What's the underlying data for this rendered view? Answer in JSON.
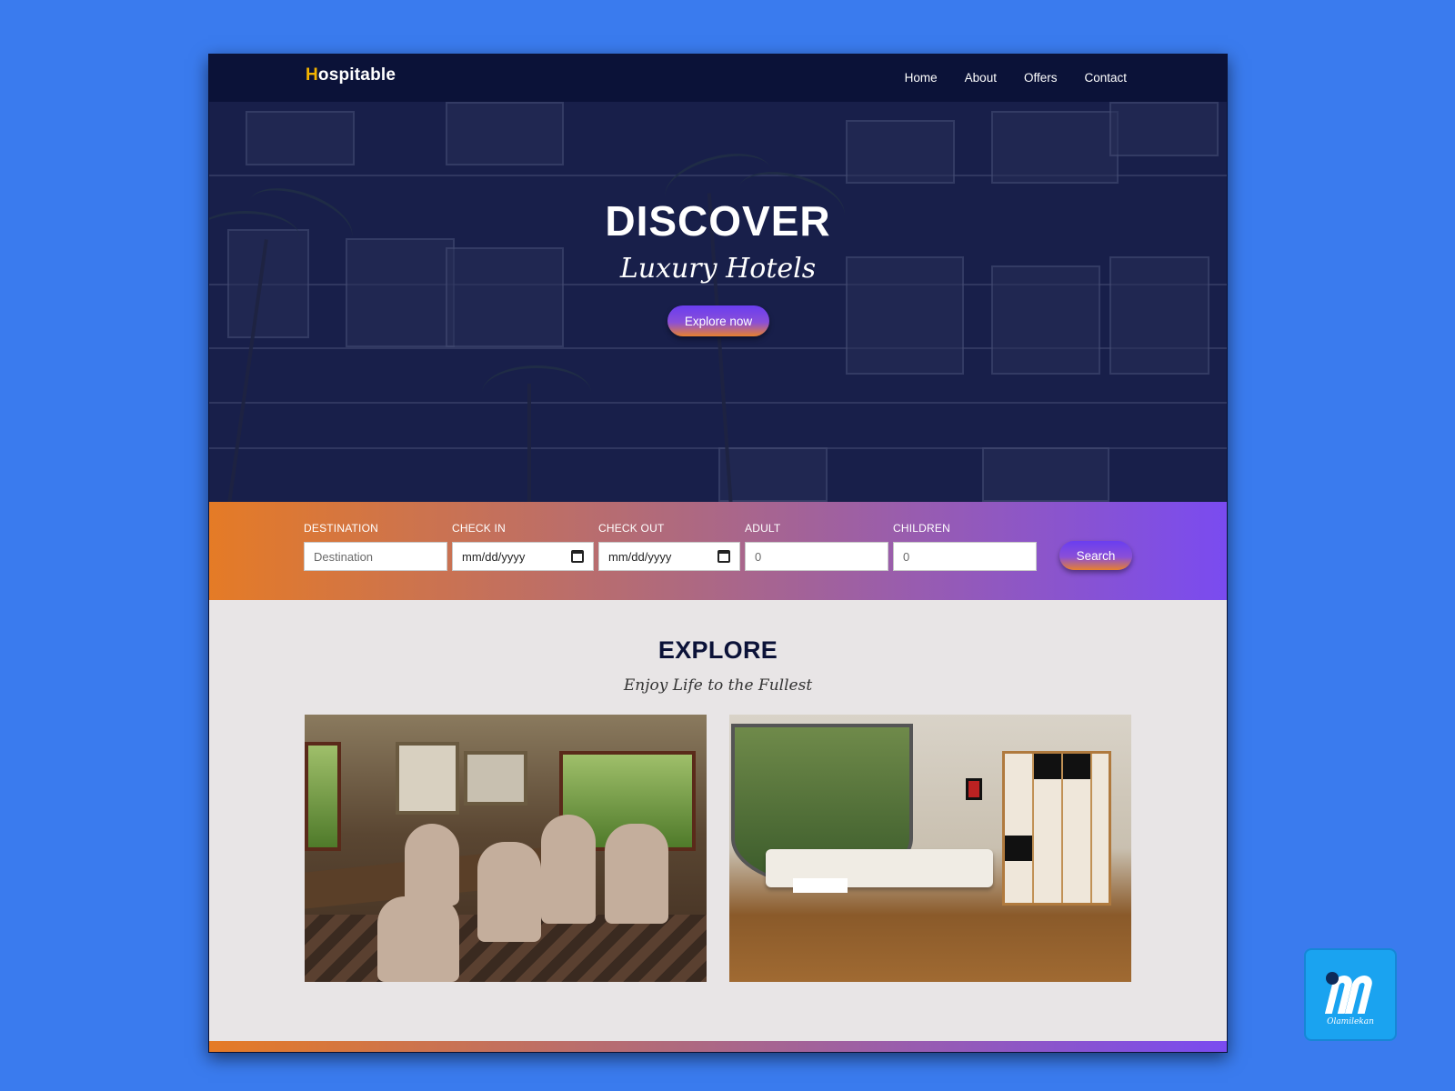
{
  "site": {
    "logo_first": "H",
    "logo_rest": "ospitable"
  },
  "nav": {
    "items": [
      {
        "label": "Home"
      },
      {
        "label": "About"
      },
      {
        "label": "Offers"
      },
      {
        "label": "Contact"
      }
    ]
  },
  "hero": {
    "title": "DISCOVER",
    "subtitle": "Luxury Hotels",
    "cta_label": "Explore now"
  },
  "booking": {
    "destination": {
      "label": "DESTINATION",
      "placeholder": "Destination",
      "value": ""
    },
    "check_in": {
      "label": "CHECK IN",
      "placeholder": "mm/dd/yyyy"
    },
    "check_out": {
      "label": "CHECK OUT",
      "placeholder": "mm/dd/yyyy"
    },
    "adult": {
      "label": "ADULT",
      "value": "0"
    },
    "children": {
      "label": "CHILDREN",
      "value": "0"
    },
    "search_label": "Search"
  },
  "explore": {
    "title": "EXPLORE",
    "subtitle": "Enjoy Life to the Fullest",
    "cards": [
      {
        "image": "dining-room-photo"
      },
      {
        "image": "living-room-photo"
      }
    ]
  },
  "colors": {
    "nav_bg": "#0b1238",
    "logo_accent": "#f4b400",
    "gradient_start": "#e57b26",
    "gradient_end": "#7a4bf0",
    "page_bg": "#3a7bee"
  },
  "badge": {
    "signature": "Olamilekan"
  }
}
